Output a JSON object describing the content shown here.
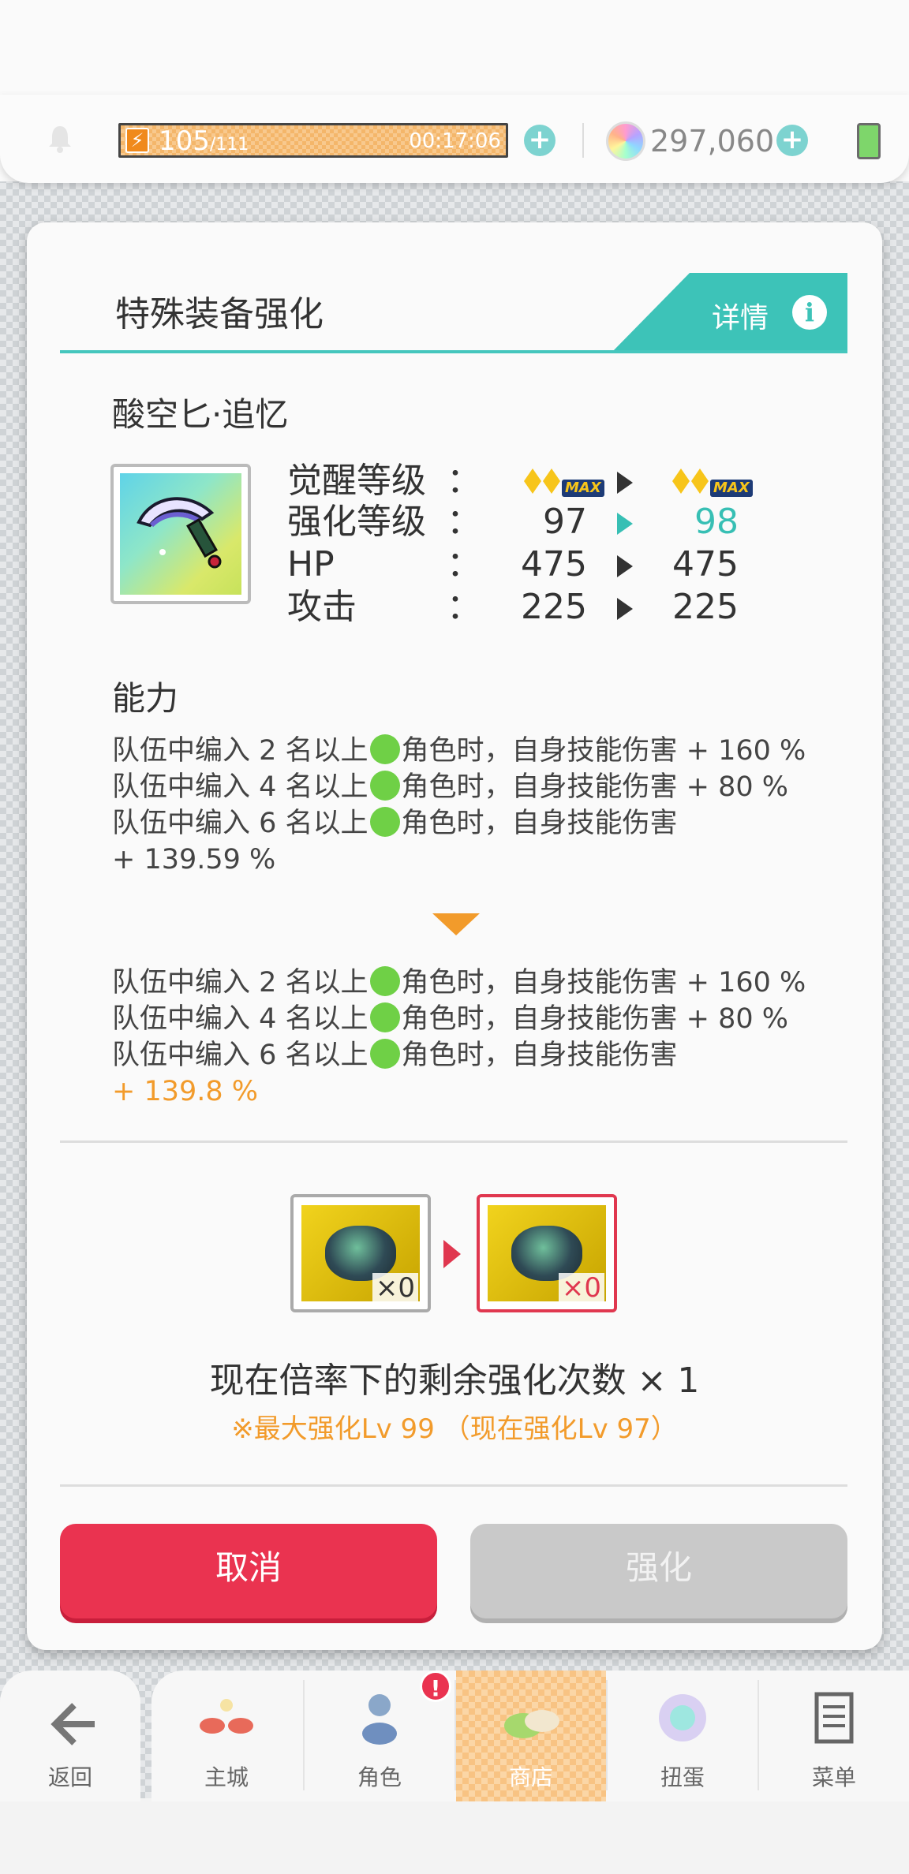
{
  "status_bar": {
    "stamina_current": "105",
    "stamina_max": "/111",
    "stamina_timer": "00:17:06",
    "gems": "297,060"
  },
  "dialog": {
    "title": "特殊装备强化",
    "detail_label": "详情",
    "item_name": "酸空匕·追忆",
    "stats": [
      {
        "label": "觉醒等级",
        "colon": "：",
        "before": "",
        "after": ""
      },
      {
        "label": "强化等级",
        "colon": "：",
        "before": "97",
        "after": "98"
      },
      {
        "label": "HP",
        "colon": "：",
        "before": "475",
        "after": "475"
      },
      {
        "label": "攻击",
        "colon": "：",
        "before": "225",
        "after": "225"
      }
    ],
    "awakening_max_badge": "MAX",
    "ability_title": "能力",
    "ability_before": [
      {
        "pre": "队伍中编入 2 名以上",
        "post": "角色时，自身技能伤害 + 160 %"
      },
      {
        "pre": "队伍中编入 4 名以上",
        "post": "角色时，自身技能伤害 + 80 %"
      },
      {
        "pre": "队伍中编入 6 名以上",
        "post": "角色时，自身技能伤害"
      },
      {
        "pre": "+ 139.59 %",
        "post": ""
      }
    ],
    "ability_after": [
      {
        "pre": "队伍中编入 2 名以上",
        "post": "角色时，自身技能伤害 + 160 %"
      },
      {
        "pre": "队伍中编入 4 名以上",
        "post": "角色时，自身技能伤害 + 80 %"
      },
      {
        "pre": "队伍中编入 6 名以上",
        "post": "角色时，自身技能伤害"
      },
      {
        "pre": "+ 139.8 %",
        "post": ""
      }
    ],
    "material_from_count": "×0",
    "material_to_count": "×0",
    "remaining_text": "现在倍率下的剩余强化次数 × 1",
    "max_level_note": "※最大强化Lv 99 （现在强化Lv 97）",
    "cancel_label": "取消",
    "enhance_label": "强化"
  },
  "nav": {
    "back": "返回",
    "items": [
      "主城",
      "角色",
      "商店",
      "扭蛋",
      "菜单"
    ],
    "active": "商店",
    "alert_badge": "!"
  },
  "colors": {
    "accent_teal": "#3dc3b8",
    "cancel_red": "#ea3350",
    "highlight_orange": "#f29b2b",
    "element_green": "#6fd046"
  }
}
